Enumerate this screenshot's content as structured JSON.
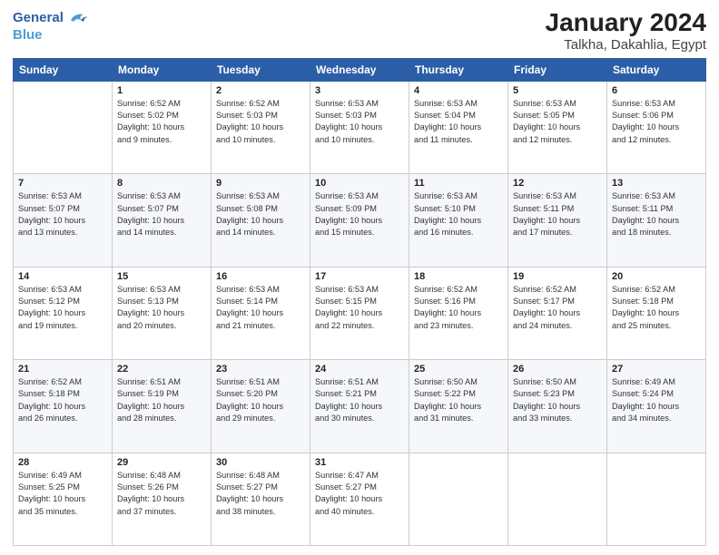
{
  "logo": {
    "line1": "General",
    "line2": "Blue"
  },
  "header": {
    "title": "January 2024",
    "subtitle": "Talkha, Dakahlia, Egypt"
  },
  "weekdays": [
    "Sunday",
    "Monday",
    "Tuesday",
    "Wednesday",
    "Thursday",
    "Friday",
    "Saturday"
  ],
  "weeks": [
    [
      {
        "day": "",
        "info": ""
      },
      {
        "day": "1",
        "info": "Sunrise: 6:52 AM\nSunset: 5:02 PM\nDaylight: 10 hours\nand 9 minutes."
      },
      {
        "day": "2",
        "info": "Sunrise: 6:52 AM\nSunset: 5:03 PM\nDaylight: 10 hours\nand 10 minutes."
      },
      {
        "day": "3",
        "info": "Sunrise: 6:53 AM\nSunset: 5:03 PM\nDaylight: 10 hours\nand 10 minutes."
      },
      {
        "day": "4",
        "info": "Sunrise: 6:53 AM\nSunset: 5:04 PM\nDaylight: 10 hours\nand 11 minutes."
      },
      {
        "day": "5",
        "info": "Sunrise: 6:53 AM\nSunset: 5:05 PM\nDaylight: 10 hours\nand 12 minutes."
      },
      {
        "day": "6",
        "info": "Sunrise: 6:53 AM\nSunset: 5:06 PM\nDaylight: 10 hours\nand 12 minutes."
      }
    ],
    [
      {
        "day": "7",
        "info": "Sunrise: 6:53 AM\nSunset: 5:07 PM\nDaylight: 10 hours\nand 13 minutes."
      },
      {
        "day": "8",
        "info": "Sunrise: 6:53 AM\nSunset: 5:07 PM\nDaylight: 10 hours\nand 14 minutes."
      },
      {
        "day": "9",
        "info": "Sunrise: 6:53 AM\nSunset: 5:08 PM\nDaylight: 10 hours\nand 14 minutes."
      },
      {
        "day": "10",
        "info": "Sunrise: 6:53 AM\nSunset: 5:09 PM\nDaylight: 10 hours\nand 15 minutes."
      },
      {
        "day": "11",
        "info": "Sunrise: 6:53 AM\nSunset: 5:10 PM\nDaylight: 10 hours\nand 16 minutes."
      },
      {
        "day": "12",
        "info": "Sunrise: 6:53 AM\nSunset: 5:11 PM\nDaylight: 10 hours\nand 17 minutes."
      },
      {
        "day": "13",
        "info": "Sunrise: 6:53 AM\nSunset: 5:11 PM\nDaylight: 10 hours\nand 18 minutes."
      }
    ],
    [
      {
        "day": "14",
        "info": "Sunrise: 6:53 AM\nSunset: 5:12 PM\nDaylight: 10 hours\nand 19 minutes."
      },
      {
        "day": "15",
        "info": "Sunrise: 6:53 AM\nSunset: 5:13 PM\nDaylight: 10 hours\nand 20 minutes."
      },
      {
        "day": "16",
        "info": "Sunrise: 6:53 AM\nSunset: 5:14 PM\nDaylight: 10 hours\nand 21 minutes."
      },
      {
        "day": "17",
        "info": "Sunrise: 6:53 AM\nSunset: 5:15 PM\nDaylight: 10 hours\nand 22 minutes."
      },
      {
        "day": "18",
        "info": "Sunrise: 6:52 AM\nSunset: 5:16 PM\nDaylight: 10 hours\nand 23 minutes."
      },
      {
        "day": "19",
        "info": "Sunrise: 6:52 AM\nSunset: 5:17 PM\nDaylight: 10 hours\nand 24 minutes."
      },
      {
        "day": "20",
        "info": "Sunrise: 6:52 AM\nSunset: 5:18 PM\nDaylight: 10 hours\nand 25 minutes."
      }
    ],
    [
      {
        "day": "21",
        "info": "Sunrise: 6:52 AM\nSunset: 5:18 PM\nDaylight: 10 hours\nand 26 minutes."
      },
      {
        "day": "22",
        "info": "Sunrise: 6:51 AM\nSunset: 5:19 PM\nDaylight: 10 hours\nand 28 minutes."
      },
      {
        "day": "23",
        "info": "Sunrise: 6:51 AM\nSunset: 5:20 PM\nDaylight: 10 hours\nand 29 minutes."
      },
      {
        "day": "24",
        "info": "Sunrise: 6:51 AM\nSunset: 5:21 PM\nDaylight: 10 hours\nand 30 minutes."
      },
      {
        "day": "25",
        "info": "Sunrise: 6:50 AM\nSunset: 5:22 PM\nDaylight: 10 hours\nand 31 minutes."
      },
      {
        "day": "26",
        "info": "Sunrise: 6:50 AM\nSunset: 5:23 PM\nDaylight: 10 hours\nand 33 minutes."
      },
      {
        "day": "27",
        "info": "Sunrise: 6:49 AM\nSunset: 5:24 PM\nDaylight: 10 hours\nand 34 minutes."
      }
    ],
    [
      {
        "day": "28",
        "info": "Sunrise: 6:49 AM\nSunset: 5:25 PM\nDaylight: 10 hours\nand 35 minutes."
      },
      {
        "day": "29",
        "info": "Sunrise: 6:48 AM\nSunset: 5:26 PM\nDaylight: 10 hours\nand 37 minutes."
      },
      {
        "day": "30",
        "info": "Sunrise: 6:48 AM\nSunset: 5:27 PM\nDaylight: 10 hours\nand 38 minutes."
      },
      {
        "day": "31",
        "info": "Sunrise: 6:47 AM\nSunset: 5:27 PM\nDaylight: 10 hours\nand 40 minutes."
      },
      {
        "day": "",
        "info": ""
      },
      {
        "day": "",
        "info": ""
      },
      {
        "day": "",
        "info": ""
      }
    ]
  ]
}
